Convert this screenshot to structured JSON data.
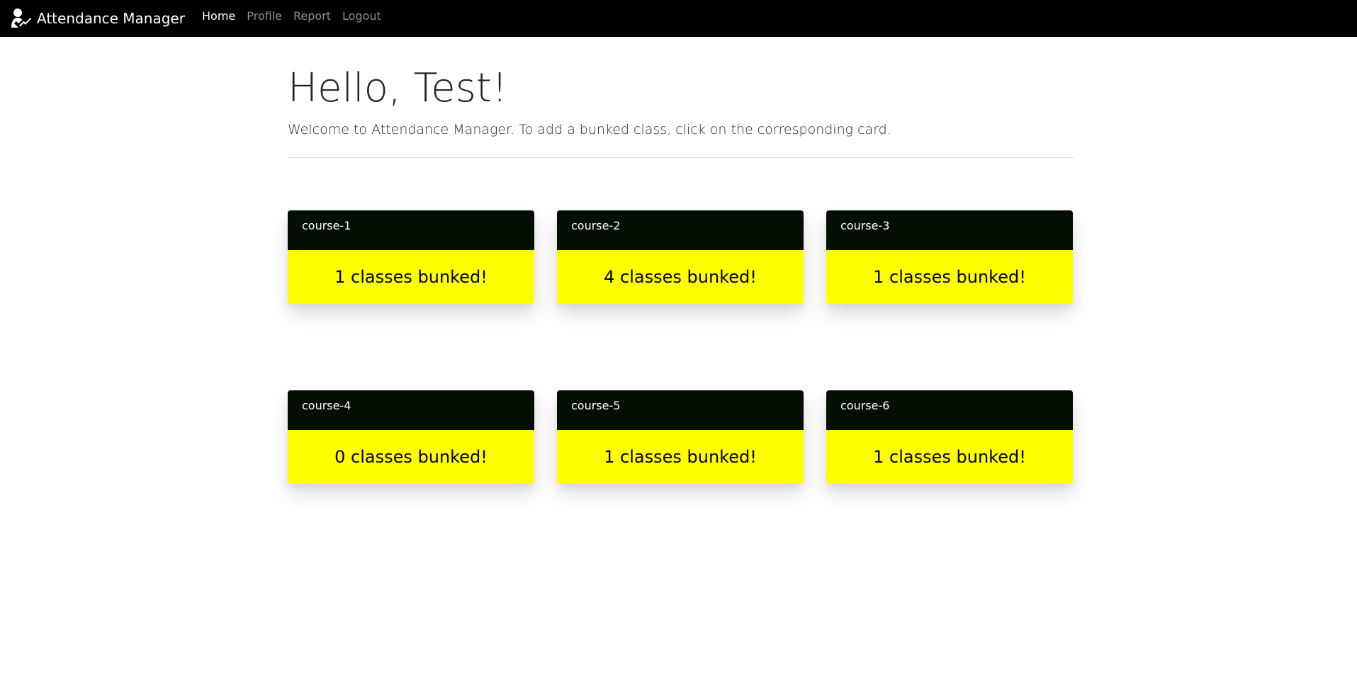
{
  "navbar": {
    "brand": "Attendance Manager",
    "brand_icon": "user-check-icon",
    "links": [
      {
        "label": "Home",
        "active": true
      },
      {
        "label": "Profile",
        "active": false
      },
      {
        "label": "Report",
        "active": false
      },
      {
        "label": "Logout",
        "active": false
      }
    ]
  },
  "main": {
    "greeting": "Hello, Test!",
    "lead": "Welcome to Attendance Manager. To add a bunked class, click on the corresponding card."
  },
  "courses": [
    {
      "name": "course-1",
      "bunked": "1 classes bunked!"
    },
    {
      "name": "course-2",
      "bunked": "4 classes bunked!"
    },
    {
      "name": "course-3",
      "bunked": "1 classes bunked!"
    },
    {
      "name": "course-4",
      "bunked": "0 classes bunked!"
    },
    {
      "name": "course-5",
      "bunked": "1 classes bunked!"
    },
    {
      "name": "course-6",
      "bunked": "1 classes bunked!"
    }
  ],
  "colors": {
    "navbar_bg": "#000000",
    "card_header_bg": "#030f02",
    "card_body_bg": "#ffff00"
  }
}
